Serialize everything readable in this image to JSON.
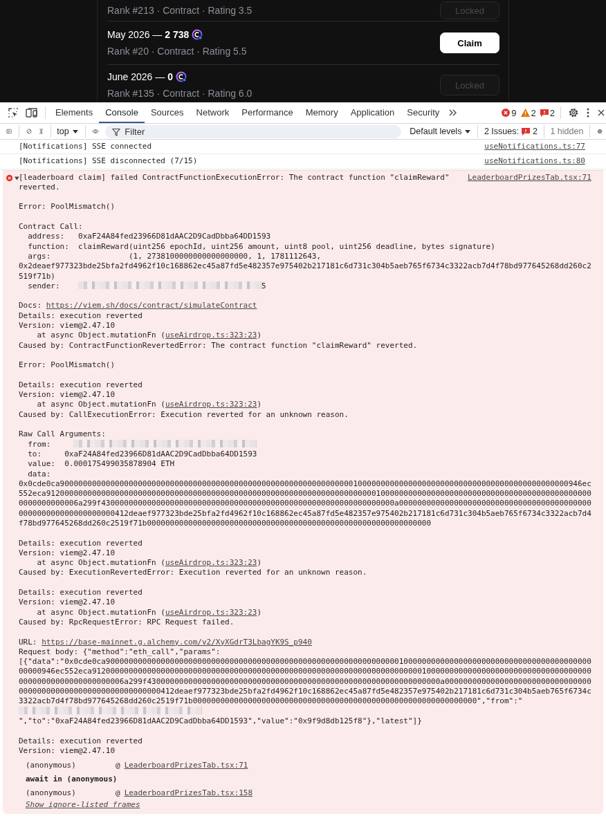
{
  "app": {
    "rows": [
      {
        "subtitle": "Rank #213 · Contract · Rating 3.5",
        "button": {
          "label": "Locked",
          "disabled": true
        }
      },
      {
        "title": "May 2026 — **2 738**",
        "subtitle": "Rank #20 · Contract · Rating 5.5",
        "button": {
          "label": "Claim",
          "disabled": false
        }
      },
      {
        "title": "June 2026 — **0**",
        "subtitle": "Rank #135 · Contract · Rating 6.0",
        "button": {
          "label": "Locked",
          "disabled": true
        }
      }
    ]
  },
  "devtools": {
    "tabs": [
      {
        "label": "Elements",
        "selected": false
      },
      {
        "label": "Console",
        "selected": true
      },
      {
        "label": "Sources",
        "selected": false
      },
      {
        "label": "Network",
        "selected": false
      },
      {
        "label": "Performance",
        "selected": false
      },
      {
        "label": "Memory",
        "selected": false
      },
      {
        "label": "Application",
        "selected": false
      },
      {
        "label": "Security",
        "selected": false
      }
    ],
    "counts": {
      "errors": "9",
      "warnings": "2",
      "issues": "2"
    },
    "toolbar": {
      "context": "top",
      "filter_placeholder": "Filter",
      "levels": "Default levels",
      "issues_label": "2 Issues:",
      "issues_count": "2",
      "hidden": "1 hidden"
    },
    "messages": [
      {
        "kind": "log",
        "text": "[Notifications] SSE connected",
        "source": "useNotifications.ts:77"
      },
      {
        "kind": "log",
        "text": "[Notifications] SSE disconnected (7/15)",
        "source": "useNotifications.ts:80"
      },
      {
        "kind": "error",
        "expanded": true,
        "text": "[leaderboard claim] failed ContractFunctionExecutionError: The contract function \"claimReward\" reverted.",
        "source": "LeaderboardPrizesTab.tsx:71",
        "paragraphs": [
          [
            {
              "kind": "text",
              "text": "Error: PoolMismatch()"
            }
          ],
          [
            {
              "kind": "text",
              "text": "Contract Call:"
            },
            {
              "kind": "text",
              "text": "  address:   0xaF24A84fed23966D81dAAC2D9CadDbba64DD1593"
            },
            {
              "kind": "text",
              "text": "  function:  claimReward(uint256 epochId, uint256 amount, uint8 pool, uint256 deadline, bytes signature)"
            },
            {
              "kind": "text",
              "text": "  args:                 (1, 2738100000000000000000, 1, 1781112643, 0x2deaef977323bde25bfa2fd4962f10c168862ec45a87fd5e482357e975402b217181c6d731c304b5aeb765f6734c3322acb7d4f78bd977645268dd260c2519f71b)"
            },
            {
              "kind": "redacted",
              "before": "  sender:    ",
              "after": "5"
            }
          ],
          [
            {
              "kind": "link",
              "before": "Docs: ",
              "link": "https://viem.sh/docs/contract/simulateContract"
            },
            {
              "kind": "text",
              "text": "Details: execution reverted"
            },
            {
              "kind": "text",
              "text": "Version: viem@2.47.10"
            },
            {
              "kind": "link",
              "before": "    at async Object.mutationFn (",
              "link": "useAirdrop.ts:323:23",
              "after": ")"
            },
            {
              "kind": "text",
              "text": "Caused by: ContractFunctionRevertedError: The contract function \"claimReward\" reverted."
            }
          ],
          [
            {
              "kind": "text",
              "text": "Error: PoolMismatch()"
            }
          ],
          [
            {
              "kind": "text",
              "text": "Details: execution reverted"
            },
            {
              "kind": "text",
              "text": "Version: viem@2.47.10"
            },
            {
              "kind": "link",
              "before": "    at async Object.mutationFn (",
              "link": "useAirdrop.ts:323:23",
              "after": ")"
            },
            {
              "kind": "text",
              "text": "Caused by: CallExecutionError: Execution reverted for an unknown reason."
            }
          ],
          [
            {
              "kind": "text",
              "text": "Raw Call Arguments:"
            },
            {
              "kind": "redacted",
              "before": "  from:     "
            },
            {
              "kind": "text",
              "text": "  to:     0xaF24A84fed23966D81dAAC2D9CadDbba64DD1593"
            },
            {
              "kind": "text",
              "text": "  value:  0.000175499035878904 ETH"
            },
            {
              "kind": "text",
              "text": "  data:"
            },
            {
              "kind": "text",
              "text": "0x0cde0ca900000000000000000000000000000000000000000000000000000000000000010000000000000000000000000000000000000000000000946ec552eca912000000000000000000000000000000000000000000000000000000000000000000000100000000000000000000000000000000000000000000000000000000006a299f4300000000000000000000000000000000000000000000000000000000000000a000000000000000000000000000000000000000000000000000000000000000412deaef977323bde25bfa2fd4962f10c168862ec45a87fd5e482357e975402b217181c6d731c304b5aeb765f6734c3322acb7d4f78bd977645268dd260c2519f71b00000000000000000000000000000000000000000000000000000000000000"
            }
          ],
          [
            {
              "kind": "text",
              "text": "Details: execution reverted"
            },
            {
              "kind": "text",
              "text": "Version: viem@2.47.10"
            },
            {
              "kind": "link",
              "before": "    at async Object.mutationFn (",
              "link": "useAirdrop.ts:323:23",
              "after": ")"
            },
            {
              "kind": "text",
              "text": "Caused by: ExecutionRevertedError: Execution reverted for an unknown reason."
            }
          ],
          [
            {
              "kind": "text",
              "text": "Details: execution reverted"
            },
            {
              "kind": "text",
              "text": "Version: viem@2.47.10"
            },
            {
              "kind": "link",
              "before": "    at async Object.mutationFn (",
              "link": "useAirdrop.ts:323:23",
              "after": ")"
            },
            {
              "kind": "text",
              "text": "Caused by: RpcRequestError: RPC Request failed."
            }
          ],
          [
            {
              "kind": "link",
              "before": "URL: ",
              "link": "https://base-mainnet.g.alchemy.com/v2/XyXGdrT3LbagYK9S_p940"
            },
            {
              "kind": "text",
              "text": "Request body: {\"method\":\"eth_call\",\"params\":"
            },
            {
              "kind": "redacted",
              "before": "[{\"data\":\"0x0cde0ca900000000000000000000000000000000000000000000000000000000000000010000000000000000000000000000000000000000000000946ec552eca912000000000000000000000000000000000000000000000000000000000000000000000100000000000000000000000000000000000000000000000000000000006a299f4300000000000000000000000000000000000000000000000000000000000000a000000000000000000000000000000000000000000000000000000000000000412deaef977323bde25bfa2fd4962f10c168862ec45a87fd5e482357e975402b217181c6d731c304b5aeb765f6734c3322acb7d4f78bd977645268dd260c2519f71b00000000000000000000000000000000000000000000000000000000000000\",\"from\":\"",
              "after": "\",\"to\":\"0xaF24A84fed23966D81dAAC2D9CadDbba64DD1593\",\"value\":\"0x9f9d8db125f8\"},\"latest\"]}"
            }
          ],
          [
            {
              "kind": "text",
              "text": "Details: execution reverted"
            },
            {
              "kind": "text",
              "text": "Version: viem@2.47.10"
            }
          ]
        ],
        "stack": [
          {
            "kind": "frame",
            "name": "(anonymous)",
            "at": "@",
            "link": "LeaderboardPrizesTab.tsx:71"
          },
          {
            "kind": "await",
            "name": "await in (anonymous)"
          },
          {
            "kind": "frame",
            "name": "(anonymous)",
            "at": "@",
            "link": "LeaderboardPrizesTab.tsx:158"
          }
        ],
        "ignore_link": "Show ignore-listed frames"
      }
    ]
  }
}
